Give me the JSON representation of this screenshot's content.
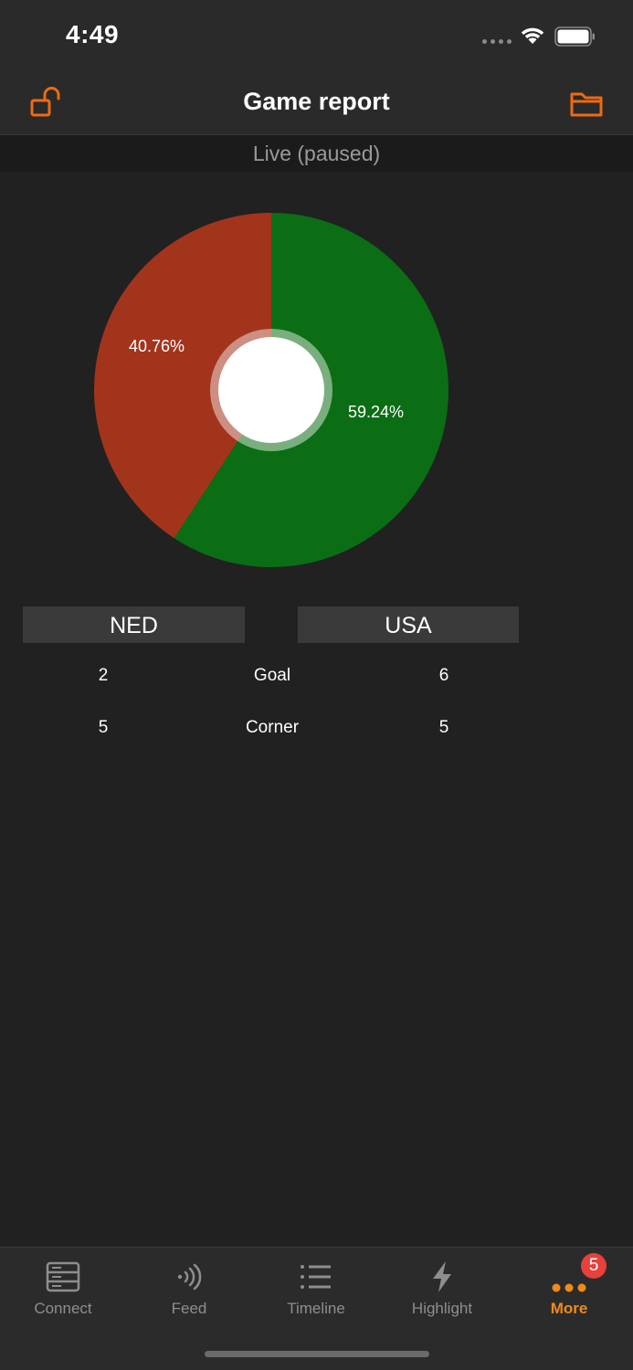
{
  "status_bar": {
    "time": "4:49"
  },
  "nav": {
    "title": "Game report",
    "left_icon": "unlock-icon",
    "right_icon": "folder-icon",
    "accent_color": "#ee6b12"
  },
  "live_status": "Live (paused)",
  "chart_data": {
    "type": "pie",
    "slices": [
      {
        "value": 59.24,
        "label": "59.24%",
        "color": "#0b6e14"
      },
      {
        "value": 40.76,
        "label": "40.76%",
        "color": "#a3341c"
      }
    ]
  },
  "teams": {
    "home": "NED",
    "away": "USA"
  },
  "stats": [
    {
      "home": "2",
      "label": "Goal",
      "away": "6"
    },
    {
      "home": "5",
      "label": "Corner",
      "away": "5"
    }
  ],
  "tabs": [
    {
      "label": "Connect",
      "icon": "server-icon"
    },
    {
      "label": "Feed",
      "icon": "broadcast-icon"
    },
    {
      "label": "Timeline",
      "icon": "list-icon"
    },
    {
      "label": "Highlight",
      "icon": "bolt-icon"
    },
    {
      "label": "More",
      "icon": "more-dots-icon",
      "active": true,
      "badge": "5"
    }
  ]
}
